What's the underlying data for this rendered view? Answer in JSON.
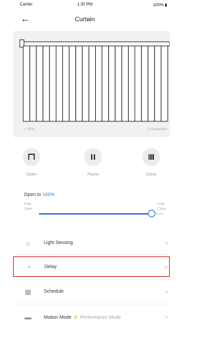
{
  "status": {
    "carrier": "Carrier",
    "time": "1:20 PM",
    "battery": "100%"
  },
  "nav": {
    "back_icon": "←",
    "title": "Curtain"
  },
  "curtain": {
    "battery": "85%",
    "connection": "Connected"
  },
  "controls": [
    {
      "label": "Open",
      "icon": "open-icon"
    },
    {
      "label": "Pause",
      "icon": "pause-icon"
    },
    {
      "label": "Close",
      "icon": "close-icon"
    }
  ],
  "open_to": {
    "prefix": "Open to",
    "value": "100%",
    "level": 0.9
  },
  "slider": {
    "left_line1": "Fully",
    "left_line2": "Open",
    "right_line1": "Fully",
    "right_line2": "Close"
  },
  "menu": {
    "light_sensing": {
      "label": "Light Sensing",
      "chevron": ">"
    },
    "delay": {
      "label": "Delay",
      "chevron": ">"
    },
    "schedule": {
      "label": "Schedule",
      "chevron": ">"
    },
    "motion_mode": {
      "label": "Motion Mode",
      "value": "Performance Mode",
      "chevron": ">"
    }
  },
  "colors": {
    "accent": "#3c82e8",
    "highlight_border": "#d22a2a"
  }
}
